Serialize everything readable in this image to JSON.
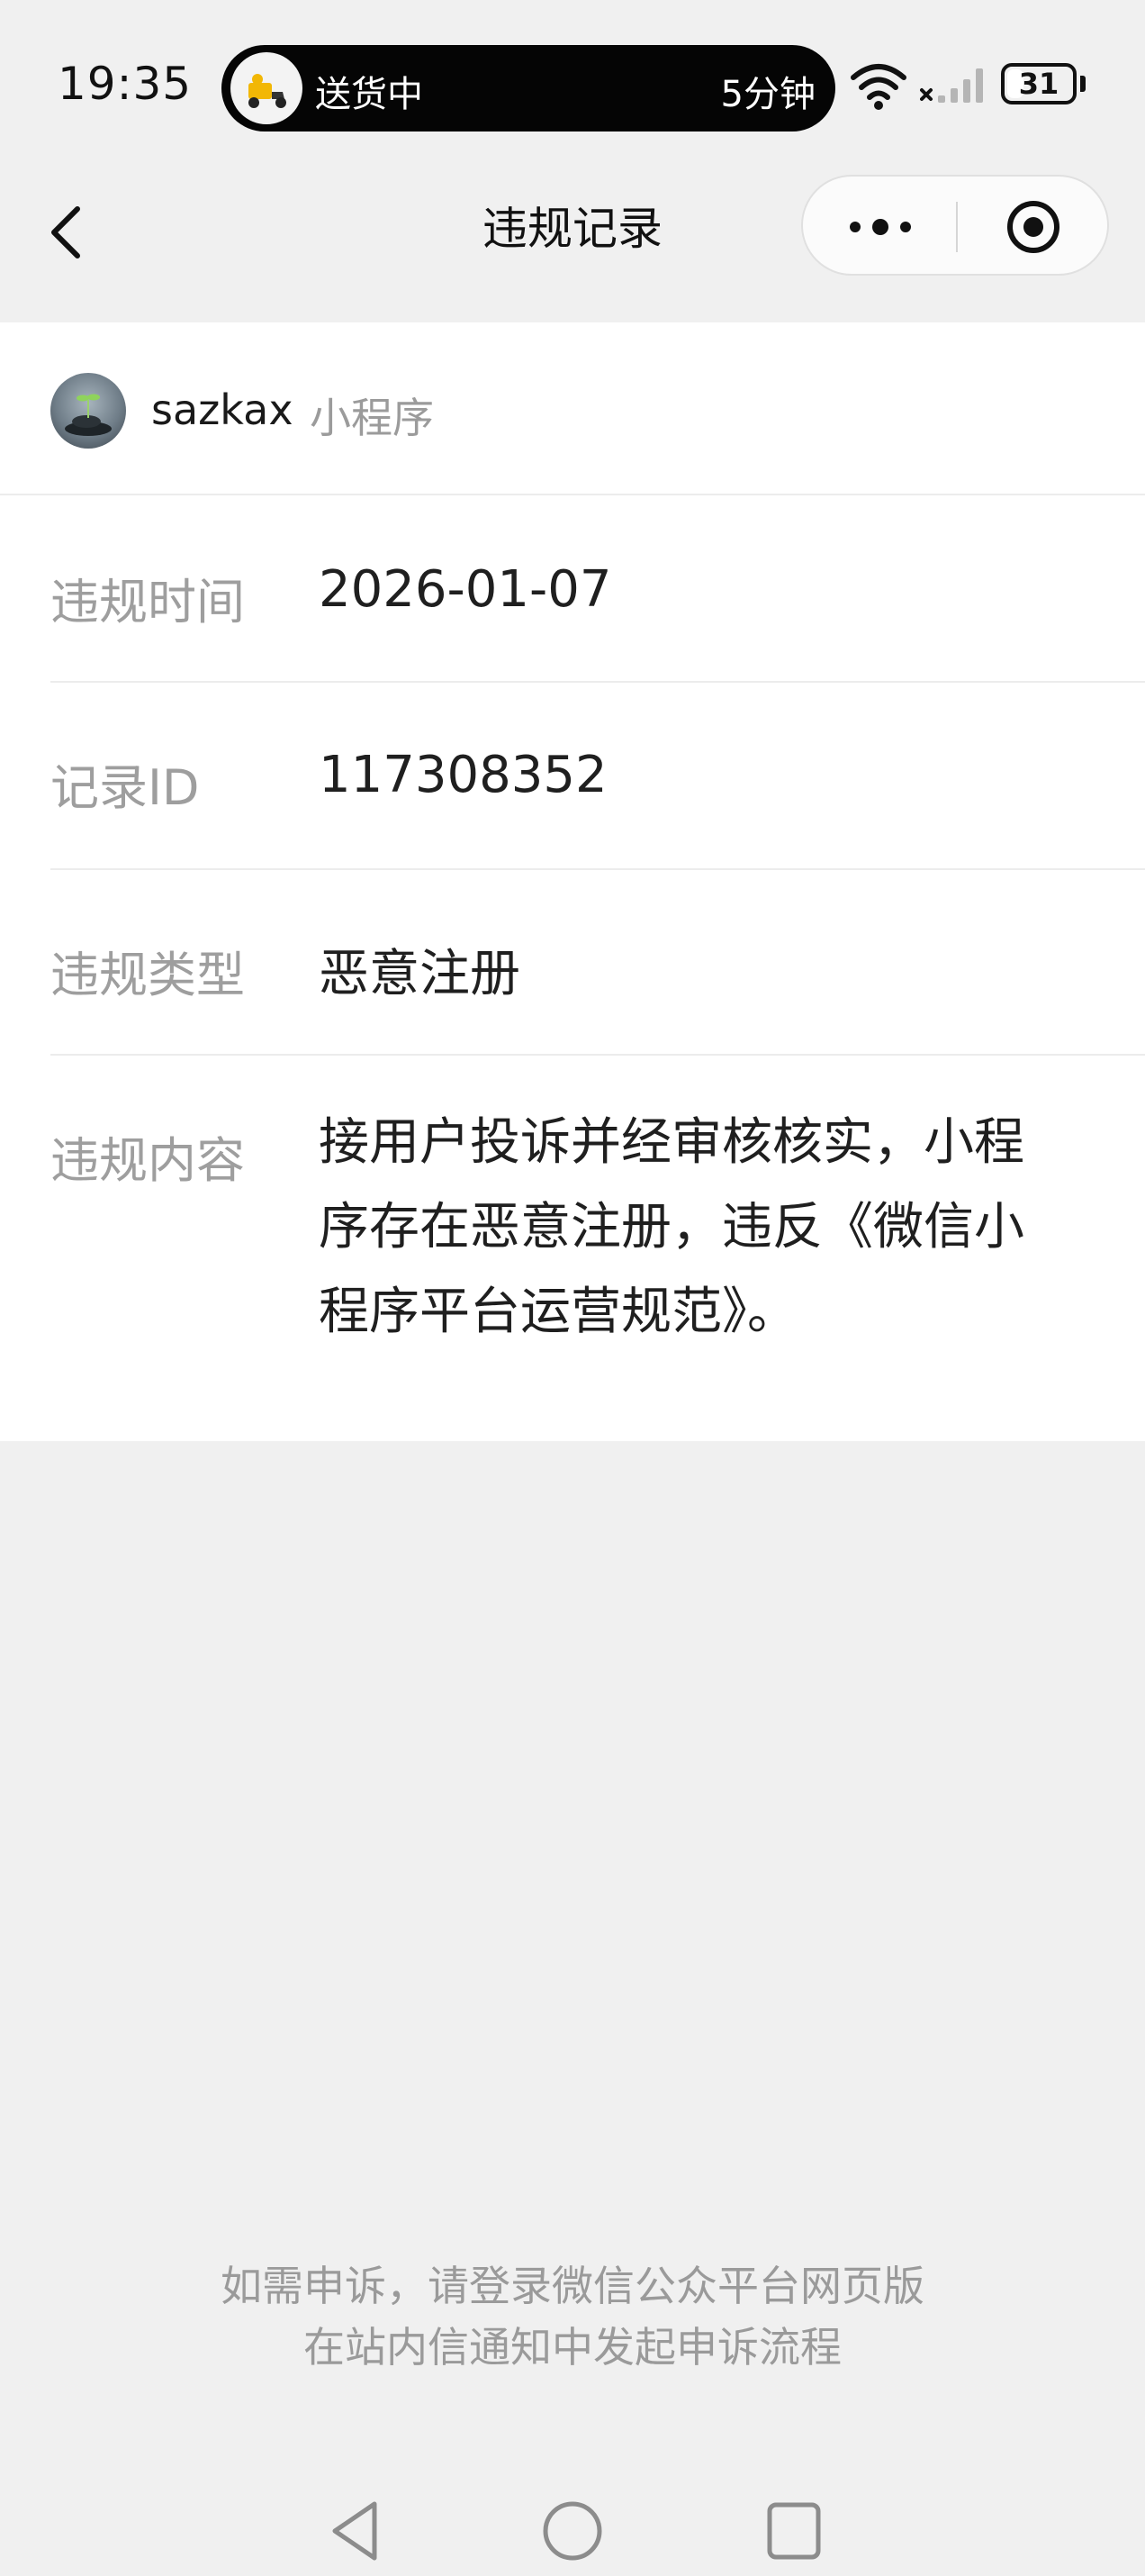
{
  "status_bar": {
    "time": "19:35",
    "live_activity": {
      "label": "送货中",
      "eta": "5分钟"
    },
    "battery": "31",
    "battery_level": 0.31
  },
  "nav": {
    "title": "违规记录"
  },
  "mini_program": {
    "name": "sazkax",
    "tag": "小程序"
  },
  "record": {
    "rows": [
      {
        "label": "违规时间",
        "value": "2026-01-07"
      },
      {
        "label": "记录ID",
        "value": "117308352"
      },
      {
        "label": "违规类型",
        "value": "恶意注册"
      }
    ],
    "content": {
      "label": "违规内容",
      "lines": [
        "接用户投诉并经审核核实，小程",
        "序存在恶意注册，违反《微信小",
        "程序平台运营规范》。"
      ]
    }
  },
  "footer": {
    "line1": "如需申诉，请登录微信公众平台网页版",
    "line2": "在站内信通知中发起申诉流程"
  },
  "icons": {
    "back": "chevron-left-icon",
    "more": "more-icon",
    "target": "target-icon",
    "wifi": "wifi-icon",
    "signal": "signal-icon",
    "battery": "battery-icon",
    "sys_back": "triangle-back-icon",
    "sys_home": "circle-home-icon",
    "sys_recent": "square-recent-icon"
  },
  "colors": {
    "page_bg": "#f0f0f0",
    "card_bg": "#ffffff",
    "label_gray": "#9e9e9e",
    "text_dark": "#1f1f1f",
    "island_bg": "#050505"
  }
}
